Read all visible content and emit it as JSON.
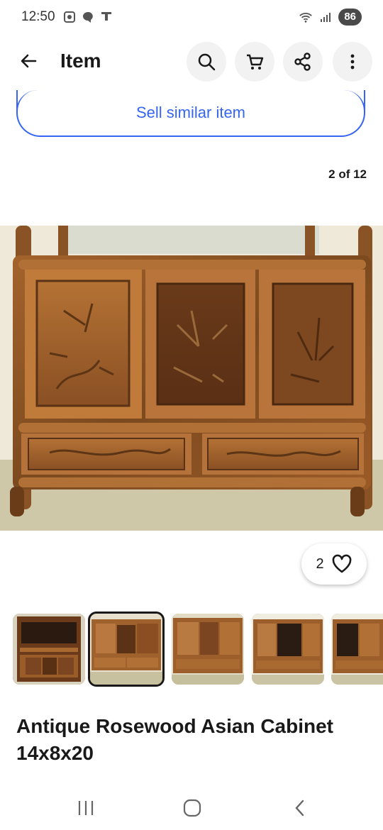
{
  "status": {
    "time": "12:50",
    "battery": "86",
    "wifi_label": "6"
  },
  "header": {
    "title": "Item"
  },
  "sell_similar_label": "Sell similar item",
  "gallery": {
    "counter": "2 of 12",
    "watch_count": "2"
  },
  "item": {
    "title": "Antique Rosewood Asian Cabinet 14x8x20"
  },
  "colors": {
    "accent": "#3665f3",
    "text": "#191919",
    "wood": "#8a5326"
  },
  "icons": [
    "back-arrow-icon",
    "search-icon",
    "cart-icon",
    "share-icon",
    "more-icon",
    "heart-icon",
    "recent-apps-icon",
    "home-icon",
    "back-nav-icon"
  ]
}
